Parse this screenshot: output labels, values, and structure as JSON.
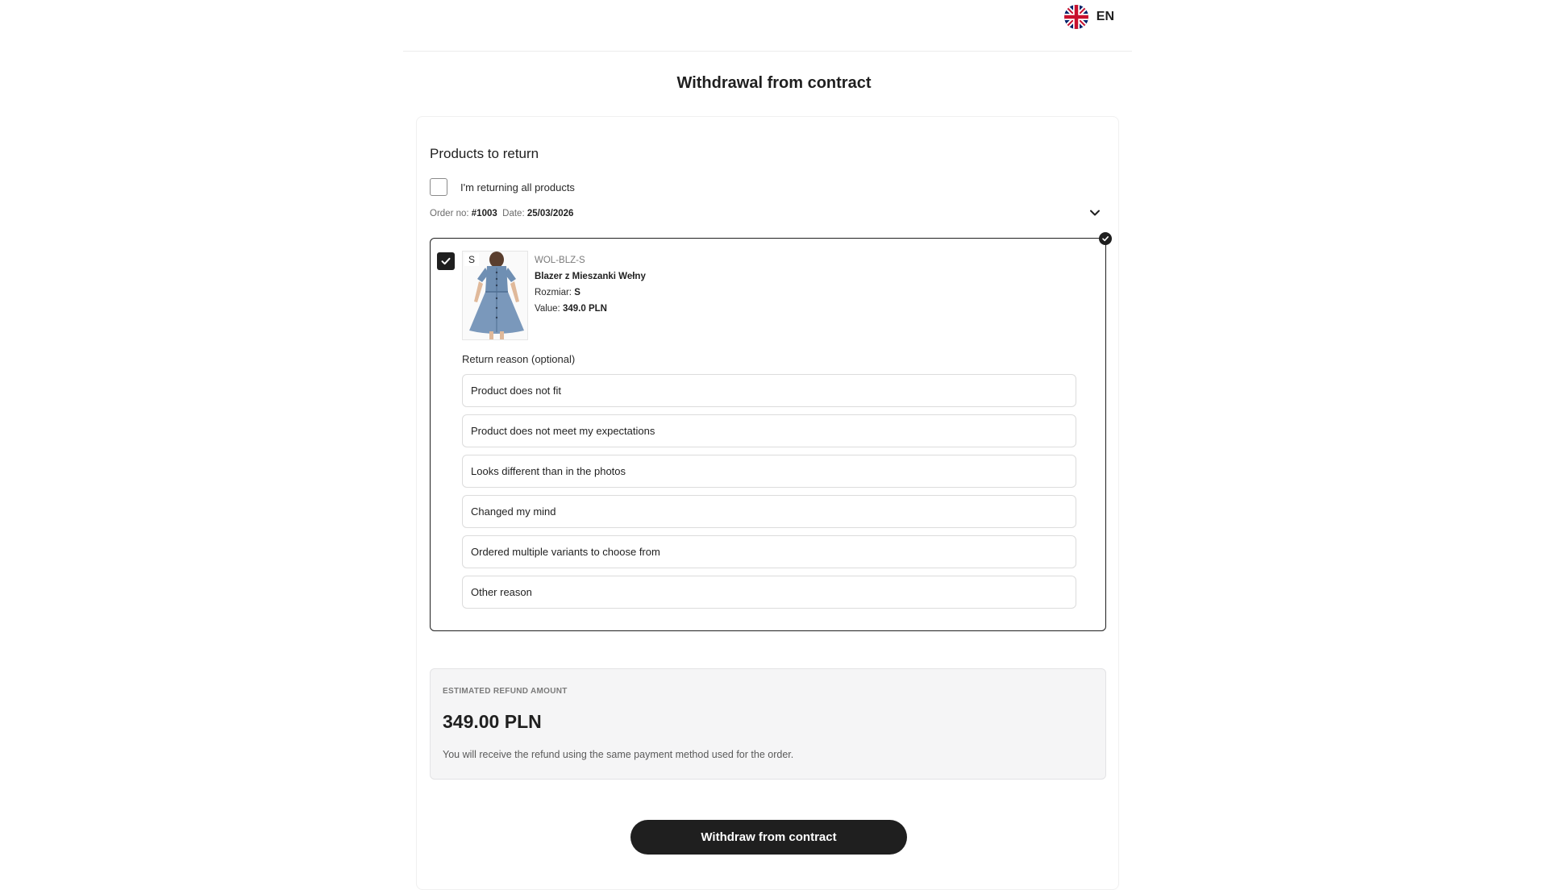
{
  "header": {
    "language_code": "EN",
    "flag_icon": "uk-flag-icon"
  },
  "page": {
    "title": "Withdrawal from contract"
  },
  "products_section": {
    "title": "Products to return",
    "all_products_label": "I'm returning all products",
    "all_products_checked": false,
    "order_no_label": "Order no:",
    "order_no": "#1003",
    "date_label": "Date:",
    "date": "25/03/2026"
  },
  "product": {
    "checked": true,
    "size_tag": "S",
    "sku": "WOL-BLZ-S",
    "name": "Blazer z Mieszanki Wełny",
    "size_label": "Rozmiar:",
    "size": "S",
    "value_label": "Value:",
    "value": "349.0 PLN"
  },
  "return_reason": {
    "label": "Return reason (optional)",
    "options": [
      "Product does not fit",
      "Product does not meet my expectations",
      "Looks different than in the photos",
      "Changed my mind",
      "Ordered multiple variants to choose from",
      "Other reason"
    ]
  },
  "refund": {
    "label": "ESTIMATED REFUND AMOUNT",
    "amount": "349.00 PLN",
    "note": "You will receive the refund using the same payment method used for the order."
  },
  "actions": {
    "submit_label": "Withdraw from contract"
  },
  "colors": {
    "primary": "#1f1f1f",
    "refund_bg": "#f5f5f6",
    "dress": "#6f8fb3"
  }
}
